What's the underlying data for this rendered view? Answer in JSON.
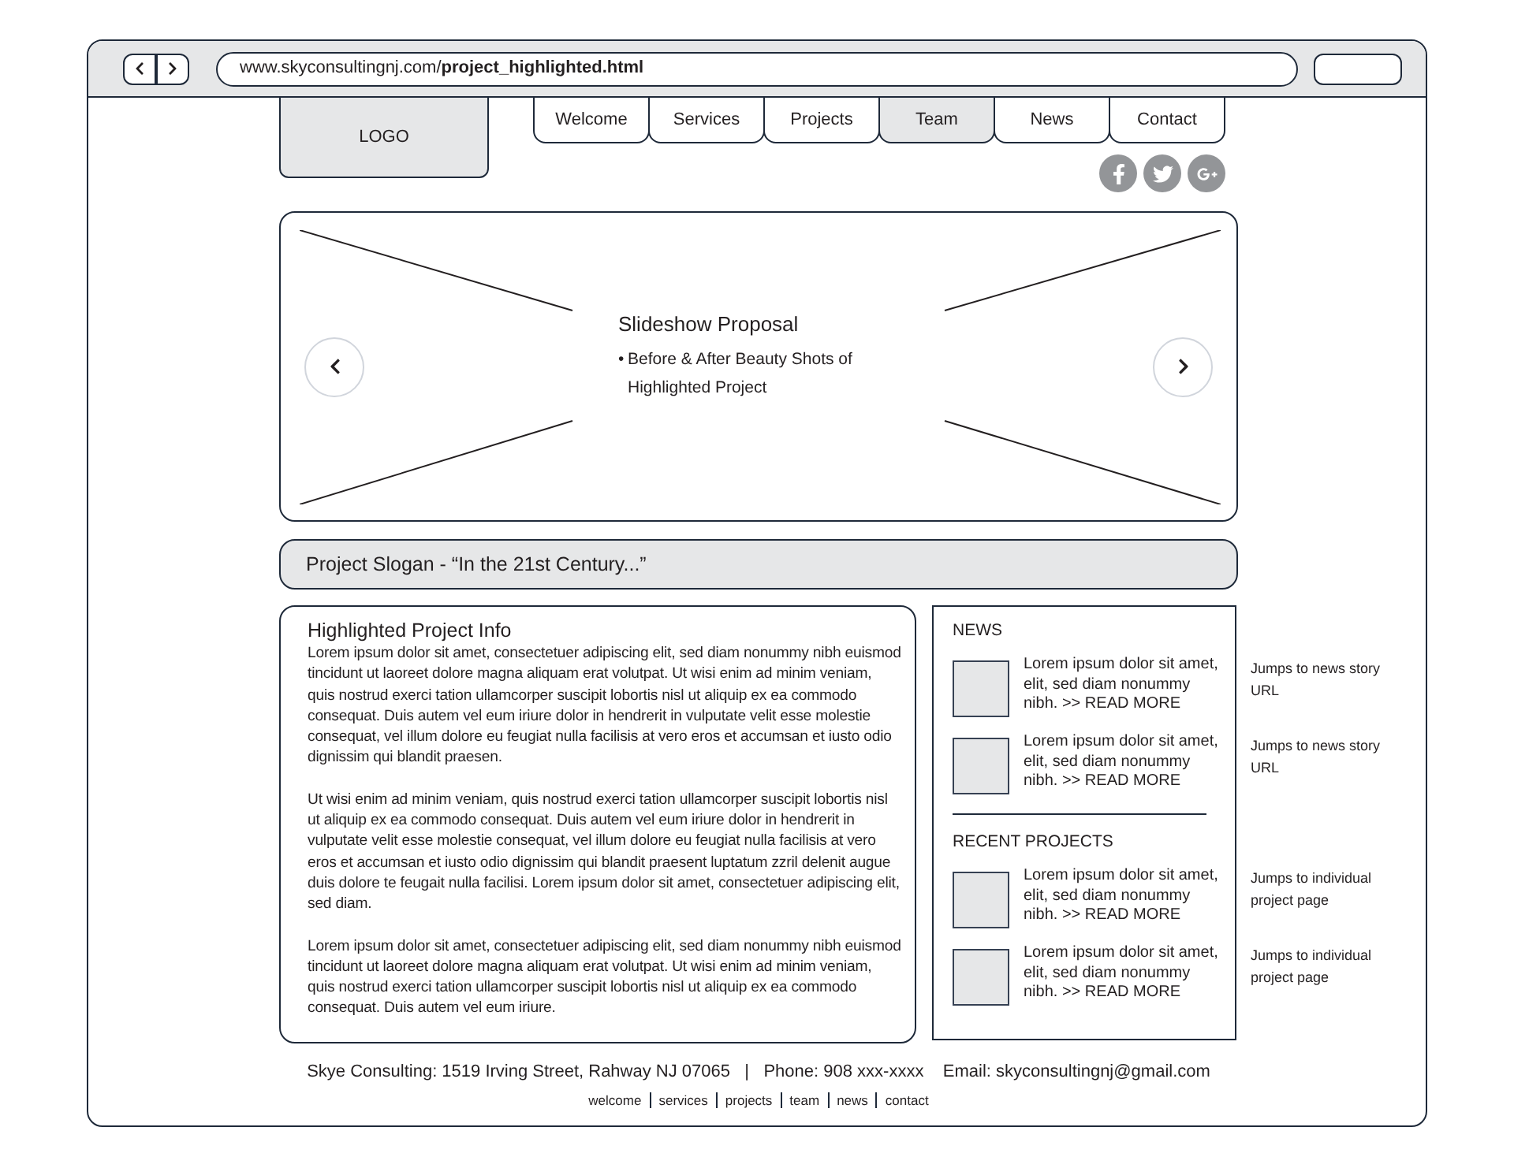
{
  "browser": {
    "url": "www.skyconsultingnj.com/**project_highlighted.html**"
  },
  "logo": "LOGO",
  "nav": [
    {
      "label": "Welcome",
      "selected": false
    },
    {
      "label": "Services",
      "selected": false
    },
    {
      "label": "Projects",
      "selected": false
    },
    {
      "label": "Team",
      "selected": true
    },
    {
      "label": "News",
      "selected": false
    },
    {
      "label": "Contact",
      "selected": false
    }
  ],
  "social": [
    {
      "kind": "facebook"
    },
    {
      "kind": "twitter"
    },
    {
      "kind": "google"
    }
  ],
  "slideshow": {
    "title": "Slideshow Proposal",
    "bullet_mark": "•",
    "bullet": "Before & After Beauty Shots of Highlighted Project"
  },
  "slogan": "Project Slogan - “In the 21st Century...”",
  "info": {
    "title": "Highlighted Project Info",
    "paragraphs": [
      "Lorem ipsum dolor sit amet, consectetuer adipiscing elit, sed diam nonummy nibh euismod tincidunt ut laoreet dolore magna aliquam erat volutpat. Ut wisi enim ad minim veniam, quis nostrud exerci tation ullamcorper suscipit lobortis nisl ut aliquip ex ea commodo consequat. Duis autem vel eum iriure dolor in hendrerit in vulputate velit esse molestie consequat, vel illum dolore eu feugiat nulla facilisis at vero eros et accumsan et iusto odio dignissim qui blandit praesen.",
      "Ut wisi enim ad minim veniam, quis nostrud exerci tation ullamcorper suscipit lobortis nisl ut aliquip ex ea commodo consequat. Duis autem vel eum iriure dolor in hendrerit in vulputate velit esse molestie consequat, vel illum dolore eu feugiat nulla facilisis at vero eros et accumsan et iusto odio dignissim qui blandit praesent luptatum zzril delenit augue duis dolore te feugait nulla facilisi. Lorem ipsum dolor sit amet, consectetuer adipiscing elit, sed diam.",
      "Lorem ipsum dolor sit amet, consectetuer adipiscing elit, sed diam nonummy nibh euismod tincidunt ut laoreet dolore magna aliquam erat volutpat. Ut wisi enim ad minim veniam, quis nostrud exerci tation ullamcorper suscipit lobortis nisl ut aliquip ex ea commodo consequat. Duis autem vel eum iriure."
    ]
  },
  "sidebar": [
    {
      "heading": "NEWS",
      "items": [
        {
          "text": "Lorem ipsum dolor sit amet, elit, sed diam nonummy nibh. >> READ MORE",
          "note": "Jumps to news story URL"
        },
        {
          "text": "Lorem ipsum dolor sit amet, elit, sed diam nonummy nibh. >> READ MORE",
          "note": "Jumps to news story URL"
        }
      ]
    },
    {
      "heading": "RECENT PROJECTS",
      "items": [
        {
          "text": "Lorem ipsum dolor sit amet, elit, sed diam nonummy nibh. >> READ MORE",
          "note": "Jumps to individual project page"
        },
        {
          "text": "Lorem ipsum dolor sit amet, elit, sed diam nonummy nibh. >> READ MORE",
          "note": "Jumps to individual project page"
        }
      ]
    }
  ],
  "footer": {
    "contact": "Skye Consulting: 1519 Irving Street, Rahway NJ 07065   |   Phone: 908 xxx-xxxx    Email: skyconsultingnj@gmail.com",
    "links": [
      "welcome",
      "services",
      "projects",
      "team",
      "news",
      "contact"
    ]
  }
}
